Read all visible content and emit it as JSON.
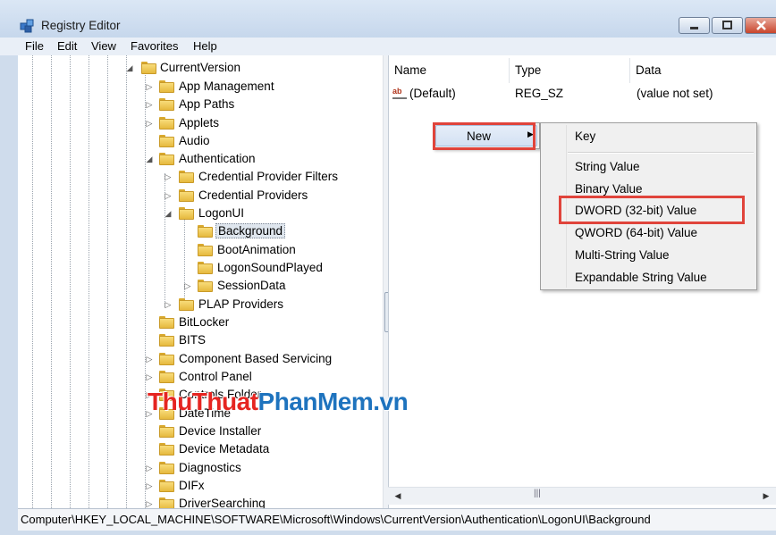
{
  "window": {
    "title": "Registry Editor"
  },
  "menubar": {
    "items": [
      "File",
      "Edit",
      "View",
      "Favorites",
      "Help"
    ]
  },
  "tree": {
    "items": [
      {
        "label": "CurrentVersion",
        "expander": "◢"
      },
      {
        "label": "App Management",
        "expander": "▷"
      },
      {
        "label": "App Paths",
        "expander": "▷"
      },
      {
        "label": "Applets",
        "expander": "▷"
      },
      {
        "label": "Audio",
        "expander": ""
      },
      {
        "label": "Authentication",
        "expander": "◢"
      },
      {
        "label": "Credential Provider Filters",
        "expander": "▷"
      },
      {
        "label": "Credential Providers",
        "expander": "▷"
      },
      {
        "label": "LogonUI",
        "expander": "◢"
      },
      {
        "label": "Background",
        "expander": "",
        "selected": true
      },
      {
        "label": "BootAnimation",
        "expander": ""
      },
      {
        "label": "LogonSoundPlayed",
        "expander": ""
      },
      {
        "label": "SessionData",
        "expander": "▷"
      },
      {
        "label": "PLAP Providers",
        "expander": "▷"
      },
      {
        "label": "BitLocker",
        "expander": ""
      },
      {
        "label": "BITS",
        "expander": ""
      },
      {
        "label": "Component Based Servicing",
        "expander": "▷"
      },
      {
        "label": "Control Panel",
        "expander": "▷"
      },
      {
        "label": "Controls Folder",
        "expander": "▷"
      },
      {
        "label": "DateTime",
        "expander": "▷"
      },
      {
        "label": "Device Installer",
        "expander": ""
      },
      {
        "label": "Device Metadata",
        "expander": ""
      },
      {
        "label": "Diagnostics",
        "expander": "▷"
      },
      {
        "label": "DIFx",
        "expander": "▷"
      },
      {
        "label": "DriverSearching",
        "expander": "▷"
      }
    ]
  },
  "list": {
    "columns": [
      "Name",
      "Type",
      "Data"
    ],
    "rows": [
      {
        "icon": "string-value-icon",
        "name": "(Default)",
        "type": "REG_SZ",
        "data": "(value not set)"
      }
    ]
  },
  "context_menu": {
    "new_label": "New"
  },
  "submenu": {
    "items": [
      "Key",
      "String Value",
      "Binary Value",
      "DWORD (32-bit) Value",
      "QWORD (64-bit) Value",
      "Multi-String Value",
      "Expandable String Value"
    ]
  },
  "statusbar": {
    "path": "Computer\\HKEY_LOCAL_MACHINE\\SOFTWARE\\Microsoft\\Windows\\CurrentVersion\\Authentication\\LogonUI\\Background"
  },
  "watermark": {
    "part1": "ThuThuat",
    "part2": "PhanMem",
    "part3": ".vn"
  },
  "colors": {
    "highlight_box": "#e0443b",
    "folder": "#f0c95a",
    "watermark_red": "#e52521",
    "watermark_blue": "#1e73be"
  }
}
